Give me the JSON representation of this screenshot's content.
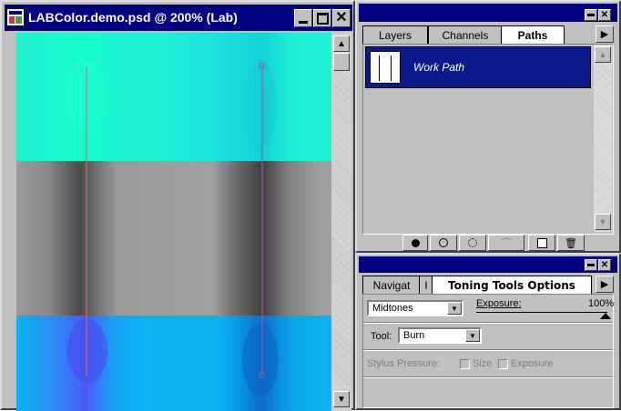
{
  "document": {
    "title": "LABColor.demo.psd @ 200% (Lab)"
  },
  "paths_panel": {
    "tabs": [
      "Layers",
      "Channels",
      "Paths"
    ],
    "active_tab": "Paths",
    "items": [
      {
        "name": "Work Path"
      }
    ],
    "footer_icons": [
      "fill-path-icon",
      "stroke-path-icon",
      "load-selection-icon",
      "make-work-path-icon",
      "new-path-icon",
      "trash-icon"
    ]
  },
  "options_panel": {
    "tabs": [
      "Navigat",
      "I",
      "Toning Tools Options"
    ],
    "active_tab": "Toning Tools Options",
    "range": "Midtones",
    "exposure_label": "Exposure:",
    "exposure_value": "100%",
    "exposure_fraction": 1.0,
    "tool_label": "Tool:",
    "tool_value": "Burn",
    "stylus_label": "Stylus Pressure:",
    "size_label": "Size",
    "exposure_check_label": "Exposure"
  },
  "colors": {
    "title_bar": "#000080",
    "panel_bg": "#c0c0c0",
    "selected_row": "#0a1a8c",
    "cyan_band": "#1ef5d2",
    "gray_band": "#8c8c8c",
    "blue_band": "#0ab4f5"
  }
}
